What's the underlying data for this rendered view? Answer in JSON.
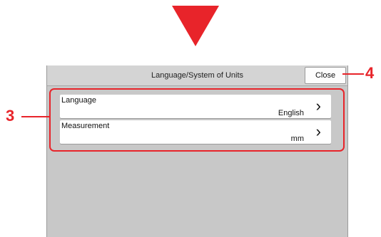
{
  "dialog": {
    "title": "Language/System of Units",
    "close_label": "Close"
  },
  "settings": [
    {
      "label": "Language",
      "value": "English"
    },
    {
      "label": "Measurement",
      "value": "mm"
    }
  ],
  "callouts": {
    "list": "3",
    "close": "4"
  },
  "colors": {
    "accent": "#e8242a",
    "panel": "#c8c8c8"
  },
  "icons": {
    "row_chevron": "chevron-right-icon",
    "arrow": "arrow-down-icon"
  }
}
